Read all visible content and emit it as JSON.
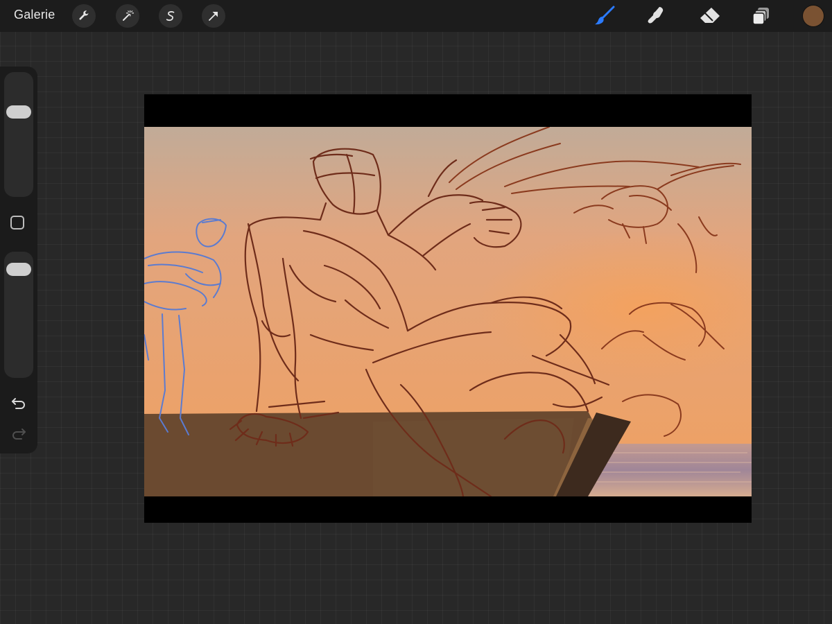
{
  "app": {
    "gallery_label": "Galerie"
  },
  "toolbar": {
    "left_tools": [
      {
        "name": "actions",
        "icon": "wrench-icon"
      },
      {
        "name": "adjustments",
        "icon": "magic-wand-icon"
      },
      {
        "name": "selection",
        "icon": "selection-s-icon"
      },
      {
        "name": "transform",
        "icon": "arrow-cursor-icon"
      }
    ],
    "right_tools": [
      {
        "name": "brush",
        "icon": "brush-icon",
        "active": true
      },
      {
        "name": "smudge",
        "icon": "smudge-finger-icon",
        "active": false
      },
      {
        "name": "eraser",
        "icon": "eraser-icon",
        "active": false
      },
      {
        "name": "layers",
        "icon": "layers-icon",
        "active": false
      }
    ],
    "current_color": "#7a5232",
    "active_color": "#2b7bff"
  },
  "sidebar": {
    "brush_size_level": 0.29,
    "opacity_level": 0.08
  },
  "canvas": {
    "sky_top": "#c1ab98",
    "sky_bottom": "#f0a060",
    "rock_color": "#6b4a30",
    "sketch_color": "#6e2c1a",
    "figure_color": "#5b7bd0",
    "sea_color": "#b9948e"
  }
}
